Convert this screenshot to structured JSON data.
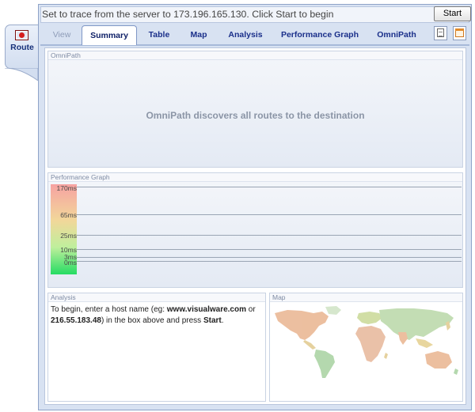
{
  "side_tab": {
    "icon": "route-icon",
    "label": "Route"
  },
  "toolbar": {
    "message": "Set to trace from the server to 173.196.165.130. Click Start to begin",
    "start_label": "Start"
  },
  "tabs": [
    {
      "label": "View",
      "state": "disabled"
    },
    {
      "label": "Summary",
      "state": "active"
    },
    {
      "label": "Table",
      "state": "normal"
    },
    {
      "label": "Map",
      "state": "normal"
    },
    {
      "label": "Analysis",
      "state": "normal"
    },
    {
      "label": "Performance Graph",
      "state": "normal"
    },
    {
      "label": "OmniPath",
      "state": "normal"
    }
  ],
  "tool_icons": [
    "document-icon",
    "window-icon"
  ],
  "omnipath": {
    "title": "OmniPath",
    "message": "OmniPath discovers all routes to the destination"
  },
  "performance": {
    "title": "Performance Graph",
    "scale_labels": [
      "170ms",
      "65ms",
      "25ms",
      "10ms",
      "3ms",
      "0ms"
    ]
  },
  "analysis": {
    "title": "Analysis",
    "text_1": "To begin, enter a host name (eg: ",
    "host_example": "www.visualware.com",
    "text_2": " or ",
    "ip_example": "216.55.183.48",
    "text_3": ") in the box above and press ",
    "start_word": "Start",
    "text_4": "."
  },
  "map": {
    "title": "Map"
  },
  "colors": {
    "tab_text": "#1a2f8a",
    "frame": "#d8e2f2",
    "panel_bg": "#e4eaf4",
    "perf_top": "#f6a2a2",
    "perf_bottom": "#25dc63"
  }
}
